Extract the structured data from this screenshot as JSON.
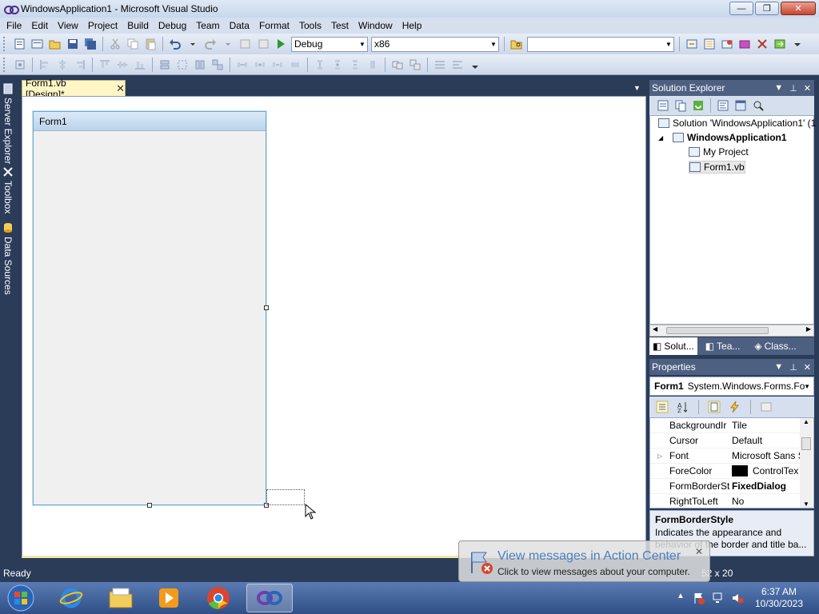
{
  "window": {
    "title": "WindowsApplication1 - Microsoft Visual Studio",
    "btn_minimize": "—",
    "btn_maximize": "❐",
    "btn_close": "✕"
  },
  "menu": [
    "File",
    "Edit",
    "View",
    "Project",
    "Build",
    "Debug",
    "Team",
    "Data",
    "Format",
    "Tools",
    "Test",
    "Window",
    "Help"
  ],
  "toolbar": {
    "config_value": "Debug",
    "platform_value": "x86",
    "find_value": ""
  },
  "left_tabs": {
    "server_explorer": "Server Explorer",
    "toolbox": "Toolbox",
    "data_sources": "Data Sources"
  },
  "document": {
    "tab_label": "Form1.vb [Design]*",
    "tab_close": "✕",
    "form_title": "Form1"
  },
  "solution_explorer": {
    "header": "Solution Explorer",
    "solution": "Solution 'WindowsApplication1' (1",
    "project": "WindowsApplication1",
    "my_project": "My Project",
    "form_file": "Form1.vb",
    "tabs": [
      "Solut...",
      "Tea...",
      "Class..."
    ]
  },
  "properties": {
    "header": "Properties",
    "object_name": "Form1",
    "object_type": "System.Windows.Forms.Fo",
    "rows": [
      {
        "name": "BackgroundIr",
        "value": "Tile",
        "bold": false,
        "expander": ""
      },
      {
        "name": "Cursor",
        "value": "Default",
        "bold": false,
        "expander": ""
      },
      {
        "name": "Font",
        "value": "Microsoft Sans S",
        "bold": false,
        "expander": "▷"
      },
      {
        "name": "ForeColor",
        "value": "ControlTex",
        "bold": false,
        "expander": ""
      },
      {
        "name": "FormBorderSt",
        "value": "FixedDialog",
        "bold": true,
        "expander": ""
      },
      {
        "name": "RightToLeft",
        "value": "No",
        "bold": false,
        "expander": ""
      }
    ],
    "desc_title": "FormBorderStyle",
    "desc_text": "Indicates the appearance and behavior of the border and title ba..."
  },
  "status": {
    "text": "Ready",
    "size": "52 x 20"
  },
  "balloon": {
    "title": "View messages in Action Center",
    "text": "Click to view messages about your computer.",
    "close": "✕"
  },
  "clock": {
    "time": "6:37 AM",
    "date": "10/30/2023"
  },
  "colors": {
    "chrome_dark": "#2b3c59",
    "panel_header": "#4d6082",
    "doc_tab": "#fff6c8"
  }
}
